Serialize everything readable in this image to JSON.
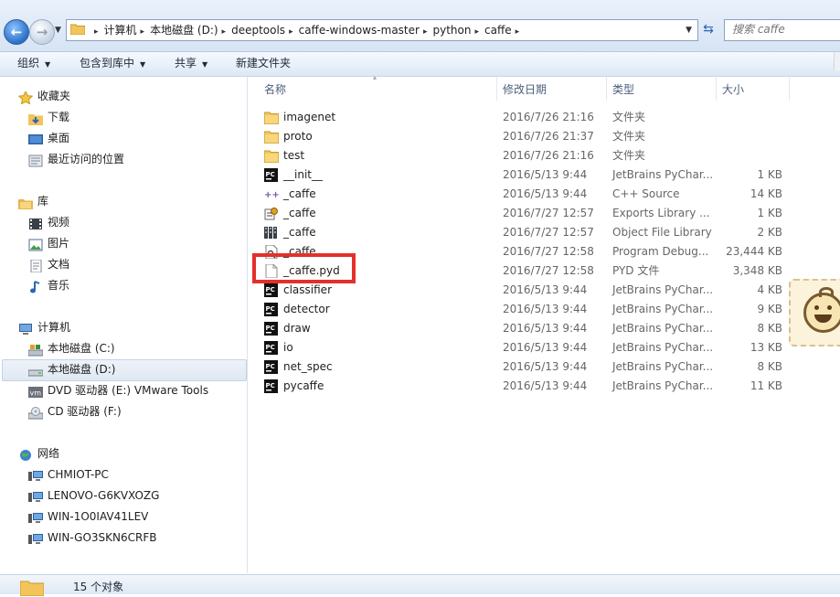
{
  "address": {
    "segments": [
      "计算机",
      "本地磁盘 (D:)",
      "deeptools",
      "caffe-windows-master",
      "python",
      "caffe"
    ],
    "search_placeholder": "搜索 caffe"
  },
  "toolbar": {
    "organize": "组织",
    "include_library": "包含到库中",
    "share": "共享",
    "new_folder": "新建文件夹"
  },
  "nav": {
    "favorites": {
      "label": "收藏夹",
      "items": [
        "下载",
        "桌面",
        "最近访问的位置"
      ]
    },
    "libraries": {
      "label": "库",
      "items": [
        "视频",
        "图片",
        "文档",
        "音乐"
      ]
    },
    "computer": {
      "label": "计算机",
      "items": [
        "本地磁盘 (C:)",
        "本地磁盘 (D:)",
        "DVD 驱动器 (E:) VMware Tools",
        "CD 驱动器 (F:)"
      ],
      "selected": "本地磁盘 (D:)"
    },
    "network": {
      "label": "网络",
      "items": [
        "CHMIOT-PC",
        "LENOVO-G6KVXOZG",
        "WIN-1O0IAV41LEV",
        "WIN-GO3SKN6CRFB"
      ]
    }
  },
  "columns": {
    "name": "名称",
    "date": "修改日期",
    "type": "类型",
    "size": "大小"
  },
  "files": [
    {
      "name": "imagenet",
      "date": "2016/7/26 21:16",
      "type": "文件夹",
      "size": "",
      "icon": "folder-icon"
    },
    {
      "name": "proto",
      "date": "2016/7/26 21:37",
      "type": "文件夹",
      "size": "",
      "icon": "folder-icon"
    },
    {
      "name": "test",
      "date": "2016/7/26 21:16",
      "type": "文件夹",
      "size": "",
      "icon": "folder-icon"
    },
    {
      "name": "__init__",
      "date": "2016/5/13 9:44",
      "type": "JetBrains PyChar...",
      "size": "1 KB",
      "icon": "pycharm-icon"
    },
    {
      "name": "_caffe",
      "date": "2016/5/13 9:44",
      "type": "C++ Source",
      "size": "14 KB",
      "icon": "cpp-source-icon"
    },
    {
      "name": "_caffe",
      "date": "2016/7/27 12:57",
      "type": "Exports Library ...",
      "size": "1 KB",
      "icon": "exports-library-icon"
    },
    {
      "name": "_caffe",
      "date": "2016/7/27 12:57",
      "type": "Object File Library",
      "size": "2 KB",
      "icon": "object-library-icon"
    },
    {
      "name": "_caffe",
      "date": "2016/7/27 12:58",
      "type": "Program Debug...",
      "size": "23,444 KB",
      "icon": "debug-file-icon"
    },
    {
      "name": "_caffe.pyd",
      "date": "2016/7/27 12:58",
      "type": "PYD 文件",
      "size": "3,348 KB",
      "icon": "blank-file-icon"
    },
    {
      "name": "classifier",
      "date": "2016/5/13 9:44",
      "type": "JetBrains PyChar...",
      "size": "4 KB",
      "icon": "pycharm-icon"
    },
    {
      "name": "detector",
      "date": "2016/5/13 9:44",
      "type": "JetBrains PyChar...",
      "size": "9 KB",
      "icon": "pycharm-icon"
    },
    {
      "name": "draw",
      "date": "2016/5/13 9:44",
      "type": "JetBrains PyChar...",
      "size": "8 KB",
      "icon": "pycharm-icon"
    },
    {
      "name": "io",
      "date": "2016/5/13 9:44",
      "type": "JetBrains PyChar...",
      "size": "13 KB",
      "icon": "pycharm-icon"
    },
    {
      "name": "net_spec",
      "date": "2016/5/13 9:44",
      "type": "JetBrains PyChar...",
      "size": "8 KB",
      "icon": "pycharm-icon"
    },
    {
      "name": "pycaffe",
      "date": "2016/5/13 9:44",
      "type": "JetBrains PyChar...",
      "size": "11 KB",
      "icon": "pycharm-icon"
    }
  ],
  "highlighted_file": "_caffe.pyd",
  "highlight_color": "#e4302b",
  "status": {
    "count_text": "15 个对象"
  }
}
